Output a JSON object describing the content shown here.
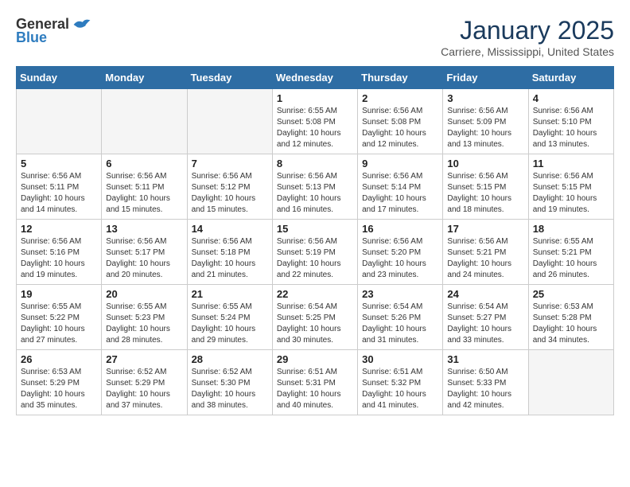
{
  "logo": {
    "general": "General",
    "blue": "Blue"
  },
  "title": "January 2025",
  "location": "Carriere, Mississippi, United States",
  "days_of_week": [
    "Sunday",
    "Monday",
    "Tuesday",
    "Wednesday",
    "Thursday",
    "Friday",
    "Saturday"
  ],
  "weeks": [
    [
      {
        "day": "",
        "info": ""
      },
      {
        "day": "",
        "info": ""
      },
      {
        "day": "",
        "info": ""
      },
      {
        "day": "1",
        "info": "Sunrise: 6:55 AM\nSunset: 5:08 PM\nDaylight: 10 hours\nand 12 minutes."
      },
      {
        "day": "2",
        "info": "Sunrise: 6:56 AM\nSunset: 5:08 PM\nDaylight: 10 hours\nand 12 minutes."
      },
      {
        "day": "3",
        "info": "Sunrise: 6:56 AM\nSunset: 5:09 PM\nDaylight: 10 hours\nand 13 minutes."
      },
      {
        "day": "4",
        "info": "Sunrise: 6:56 AM\nSunset: 5:10 PM\nDaylight: 10 hours\nand 13 minutes."
      }
    ],
    [
      {
        "day": "5",
        "info": "Sunrise: 6:56 AM\nSunset: 5:11 PM\nDaylight: 10 hours\nand 14 minutes."
      },
      {
        "day": "6",
        "info": "Sunrise: 6:56 AM\nSunset: 5:11 PM\nDaylight: 10 hours\nand 15 minutes."
      },
      {
        "day": "7",
        "info": "Sunrise: 6:56 AM\nSunset: 5:12 PM\nDaylight: 10 hours\nand 15 minutes."
      },
      {
        "day": "8",
        "info": "Sunrise: 6:56 AM\nSunset: 5:13 PM\nDaylight: 10 hours\nand 16 minutes."
      },
      {
        "day": "9",
        "info": "Sunrise: 6:56 AM\nSunset: 5:14 PM\nDaylight: 10 hours\nand 17 minutes."
      },
      {
        "day": "10",
        "info": "Sunrise: 6:56 AM\nSunset: 5:15 PM\nDaylight: 10 hours\nand 18 minutes."
      },
      {
        "day": "11",
        "info": "Sunrise: 6:56 AM\nSunset: 5:15 PM\nDaylight: 10 hours\nand 19 minutes."
      }
    ],
    [
      {
        "day": "12",
        "info": "Sunrise: 6:56 AM\nSunset: 5:16 PM\nDaylight: 10 hours\nand 19 minutes."
      },
      {
        "day": "13",
        "info": "Sunrise: 6:56 AM\nSunset: 5:17 PM\nDaylight: 10 hours\nand 20 minutes."
      },
      {
        "day": "14",
        "info": "Sunrise: 6:56 AM\nSunset: 5:18 PM\nDaylight: 10 hours\nand 21 minutes."
      },
      {
        "day": "15",
        "info": "Sunrise: 6:56 AM\nSunset: 5:19 PM\nDaylight: 10 hours\nand 22 minutes."
      },
      {
        "day": "16",
        "info": "Sunrise: 6:56 AM\nSunset: 5:20 PM\nDaylight: 10 hours\nand 23 minutes."
      },
      {
        "day": "17",
        "info": "Sunrise: 6:56 AM\nSunset: 5:21 PM\nDaylight: 10 hours\nand 24 minutes."
      },
      {
        "day": "18",
        "info": "Sunrise: 6:55 AM\nSunset: 5:21 PM\nDaylight: 10 hours\nand 26 minutes."
      }
    ],
    [
      {
        "day": "19",
        "info": "Sunrise: 6:55 AM\nSunset: 5:22 PM\nDaylight: 10 hours\nand 27 minutes."
      },
      {
        "day": "20",
        "info": "Sunrise: 6:55 AM\nSunset: 5:23 PM\nDaylight: 10 hours\nand 28 minutes."
      },
      {
        "day": "21",
        "info": "Sunrise: 6:55 AM\nSunset: 5:24 PM\nDaylight: 10 hours\nand 29 minutes."
      },
      {
        "day": "22",
        "info": "Sunrise: 6:54 AM\nSunset: 5:25 PM\nDaylight: 10 hours\nand 30 minutes."
      },
      {
        "day": "23",
        "info": "Sunrise: 6:54 AM\nSunset: 5:26 PM\nDaylight: 10 hours\nand 31 minutes."
      },
      {
        "day": "24",
        "info": "Sunrise: 6:54 AM\nSunset: 5:27 PM\nDaylight: 10 hours\nand 33 minutes."
      },
      {
        "day": "25",
        "info": "Sunrise: 6:53 AM\nSunset: 5:28 PM\nDaylight: 10 hours\nand 34 minutes."
      }
    ],
    [
      {
        "day": "26",
        "info": "Sunrise: 6:53 AM\nSunset: 5:29 PM\nDaylight: 10 hours\nand 35 minutes."
      },
      {
        "day": "27",
        "info": "Sunrise: 6:52 AM\nSunset: 5:29 PM\nDaylight: 10 hours\nand 37 minutes."
      },
      {
        "day": "28",
        "info": "Sunrise: 6:52 AM\nSunset: 5:30 PM\nDaylight: 10 hours\nand 38 minutes."
      },
      {
        "day": "29",
        "info": "Sunrise: 6:51 AM\nSunset: 5:31 PM\nDaylight: 10 hours\nand 40 minutes."
      },
      {
        "day": "30",
        "info": "Sunrise: 6:51 AM\nSunset: 5:32 PM\nDaylight: 10 hours\nand 41 minutes."
      },
      {
        "day": "31",
        "info": "Sunrise: 6:50 AM\nSunset: 5:33 PM\nDaylight: 10 hours\nand 42 minutes."
      },
      {
        "day": "",
        "info": ""
      }
    ]
  ]
}
